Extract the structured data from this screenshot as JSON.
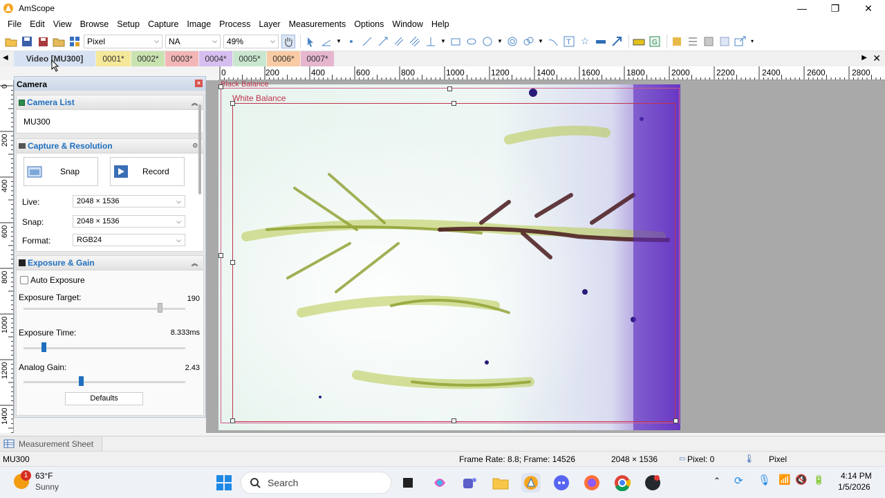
{
  "window": {
    "title": "AmScope",
    "controls": [
      "—",
      "❐",
      "✕"
    ]
  },
  "menu": [
    "File",
    "Edit",
    "View",
    "Browse",
    "Setup",
    "Capture",
    "Image",
    "Process",
    "Layer",
    "Measurements",
    "Options",
    "Window",
    "Help"
  ],
  "toolbar": {
    "unit_select": "Pixel",
    "na_select": "NA",
    "zoom_select": "49%"
  },
  "tabs": [
    {
      "label": "Video [MU300]",
      "color": "#d6e2f3"
    },
    {
      "label": "0001*",
      "color": "#f6e89a"
    },
    {
      "label": "0002*",
      "color": "#c9e3b0"
    },
    {
      "label": "0003*",
      "color": "#f2b6b6"
    },
    {
      "label": "0004*",
      "color": "#d6bff0"
    },
    {
      "label": "0005*",
      "color": "#c9e7cf"
    },
    {
      "label": "0006*",
      "color": "#f8cba4"
    },
    {
      "label": "0007*",
      "color": "#e6b6cf"
    }
  ],
  "ruler": {
    "top_labels": [
      "0",
      "200",
      "400",
      "600",
      "800",
      "1000",
      "1200",
      "1400",
      "1600",
      "1800",
      "2000",
      "2200",
      "2400",
      "2600",
      "2800"
    ],
    "left_labels": [
      "0",
      "200",
      "400",
      "600",
      "800",
      "1000",
      "1200",
      "1400"
    ]
  },
  "panel": {
    "title": "Camera",
    "camera_list": {
      "header": "Camera List",
      "item": "MU300"
    },
    "capture": {
      "header": "Capture & Resolution",
      "snap_button": "Snap",
      "record_button": "Record",
      "live_label": "Live:",
      "live_value": "2048 × 1536",
      "snap_label": "Snap:",
      "snap_value": "2048 × 1536",
      "format_label": "Format:",
      "format_value": "RGB24"
    },
    "exposure": {
      "header": "Exposure & Gain",
      "auto_exposure": "Auto Exposure",
      "target_label": "Exposure Target:",
      "target_value": "190",
      "time_label": "Exposure Time:",
      "time_value": "8.333ms",
      "gain_label": "Analog Gain:",
      "gain_value": "2.43",
      "defaults_button": "Defaults"
    }
  },
  "overlays": {
    "black_balance": "Black Balance",
    "white_balance": "White Balance"
  },
  "bottom": {
    "measurement_sheet": "Measurement Sheet"
  },
  "status": {
    "camera": "MU300",
    "frame": "Frame Rate: 8.8; Frame: 14526",
    "resolution": "2048 × 1536",
    "pixel": "Pixel: 0",
    "unit": "Pixel"
  },
  "taskbar": {
    "weather_temp": "63°F",
    "weather_desc": "Sunny",
    "weather_badge": "1",
    "search_placeholder": "Search",
    "time": "4:14 PM",
    "date": "1/5/2026"
  }
}
